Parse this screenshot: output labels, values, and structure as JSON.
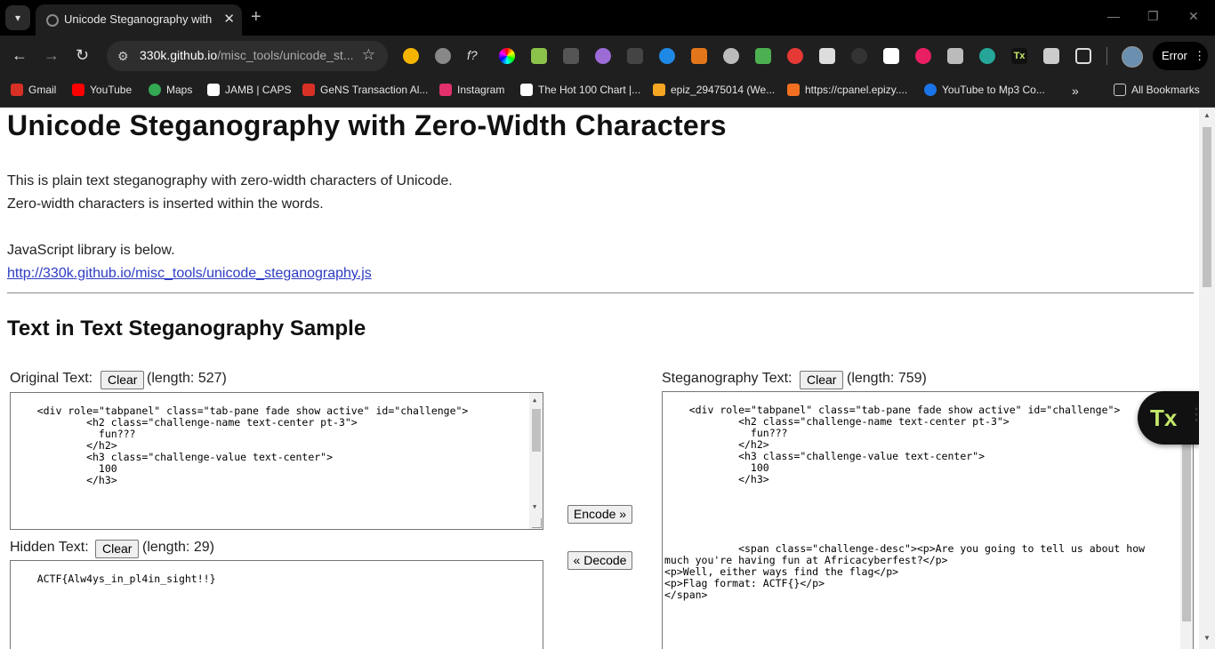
{
  "browser": {
    "tab_title": "Unicode Steganography with Zero-Width Characters",
    "url_host": "330k.github.io",
    "url_path": "/misc_tools/unicode_st...",
    "error_label": "Error",
    "bookmarks": [
      {
        "label": "Gmail",
        "color": "#d93025"
      },
      {
        "label": "YouTube",
        "color": "#ff0000"
      },
      {
        "label": "Maps",
        "color": "#34a853"
      },
      {
        "label": "JAMB | CAPS",
        "color": "#ffffff"
      },
      {
        "label": "GeNS Transaction Al...",
        "color": "#d93025"
      },
      {
        "label": "Instagram",
        "color": "#e1306c"
      },
      {
        "label": "The Hot 100 Chart |...",
        "color": "#ffffff"
      },
      {
        "label": "epiz_29475014 (We...",
        "color": "#f5a623"
      },
      {
        "label": "https://cpanel.epizy....",
        "color": "#f37021"
      },
      {
        "label": "YouTube to Mp3 Co...",
        "color": "#1a73e8"
      }
    ],
    "all_bookmarks": "All Bookmarks",
    "more_bookmarks": "»"
  },
  "page": {
    "title": "Unicode Steganography with Zero-Width Characters",
    "intro_line1": "This is plain text steganography with zero-width characters of Unicode.",
    "intro_line2": "Zero-width characters is inserted within the words.",
    "library_text": "JavaScript library is below.",
    "library_link": "http://330k.github.io/misc_tools/unicode_steganography.js",
    "section_title": "Text in Text Steganography Sample"
  },
  "original": {
    "label": "Original Text:",
    "clear": "Clear",
    "length": "(length: 527)",
    "text": "<div role=\"tabpanel\" class=\"tab-pane fade show active\" id=\"challenge\">\n            <h2 class=\"challenge-name text-center pt-3\">\n              fun???\n            </h2>\n            <h3 class=\"challenge-value text-center\">\n              100\n            </h3>\n\n\n\n\n\n            <span class=\"challenge-desc\"><p>Are you going to tell us about how"
  },
  "hidden": {
    "label": "Hidden Text:",
    "clear": "Clear",
    "length": "(length: 29)",
    "text": "ACTF{Alw4ys_in_pl4in_sight!!}"
  },
  "actions": {
    "encode": "Encode »",
    "decode": "« Decode"
  },
  "steg": {
    "label": "Steganography Text:",
    "clear": "Clear",
    "length": "(length: 759)",
    "text": "<div role=\"tabpanel\" class=\"tab-pane fade show active\" id=\"challenge\">\n            <h2 class=\"challenge-name text-center pt-3\">\n              fun???\n            </h2>\n            <h3 class=\"challenge-value text-center\">\n              100\n            </h3>\n\n\n\n\n\n            <span class=\"challenge-desc\"><p>Are you going to tell us about how\nmuch you're having fun at Africacyberfest?</p>\n<p>Well, either ways find the flag</p>\n<p>Flag format: ACTF{}</p>\n</span>"
  },
  "widget": {
    "label": "Tx"
  }
}
